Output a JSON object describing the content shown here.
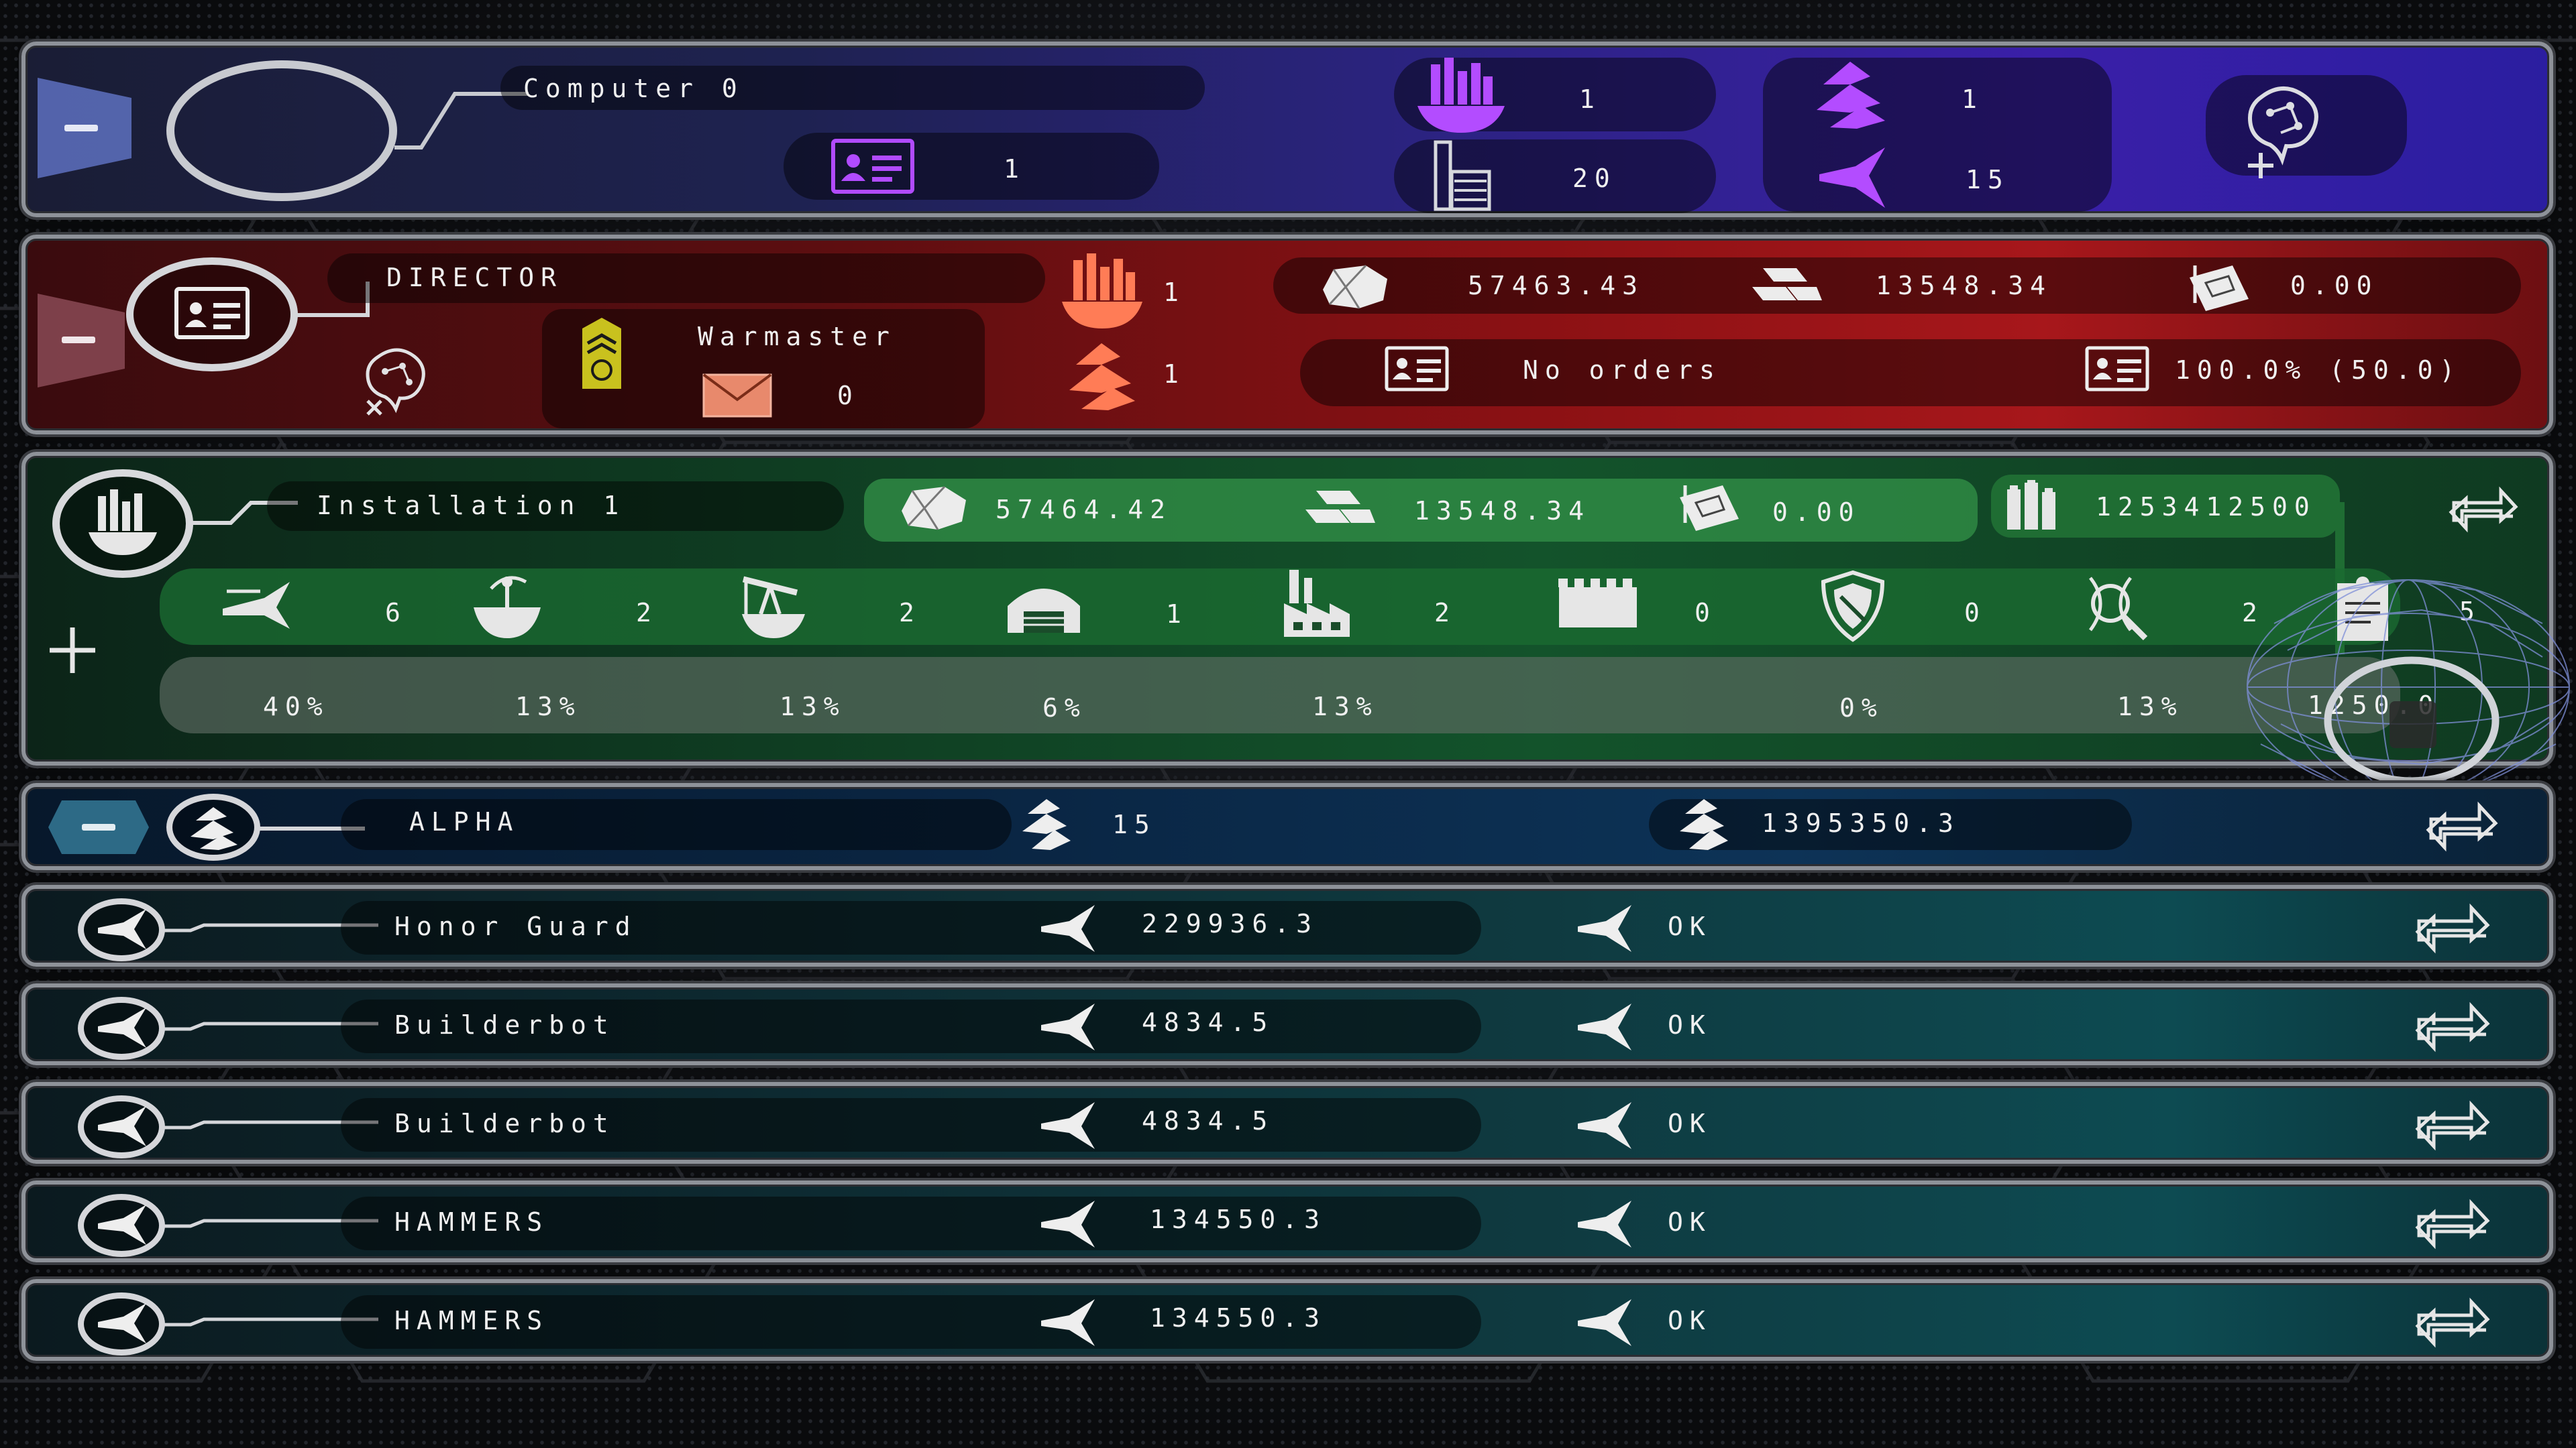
{
  "computer": {
    "name": "Computer 0",
    "id_count": "1",
    "cities_count": "1",
    "buildings_count": "20",
    "fleet_count": "1",
    "ships_count": "15",
    "colors": {
      "accent": "#a64bff",
      "panel": "#2b2380"
    }
  },
  "director": {
    "role": "DIRECTOR",
    "rank": "Warmaster",
    "mail_count": "0",
    "cities_count": "1",
    "fleets_count": "1",
    "ore": "57463.43",
    "metal": "13548.34",
    "research": "0.00",
    "orders": "No orders",
    "efficiency": "100.0% (50.0)",
    "colors": {
      "accent": "#ff7a55",
      "panel": "#a7171b"
    }
  },
  "installation": {
    "name": "Installation 1",
    "ore": "57464.42",
    "metal": "13548.34",
    "research": "0.00",
    "credits": "1253412500",
    "buildings": [
      {
        "icon": "shipyard-icon",
        "count": "6",
        "percent": "40%"
      },
      {
        "icon": "satellite-dish-icon",
        "count": "2",
        "percent": "13%"
      },
      {
        "icon": "pumpjack-icon",
        "count": "2",
        "percent": "13%"
      },
      {
        "icon": "hangar-icon",
        "count": "1",
        "percent": "6%"
      },
      {
        "icon": "factory-icon",
        "count": "2",
        "percent": "13%"
      },
      {
        "icon": "wall-icon",
        "count": "0",
        "percent": ""
      },
      {
        "icon": "shield-icon",
        "count": "0",
        "percent": "0%"
      },
      {
        "icon": "research-lab-icon",
        "count": "2",
        "percent": "13%"
      },
      {
        "icon": "document-icon",
        "count": "5",
        "percent": "1250.0"
      }
    ],
    "colors": {
      "accent": "#7fe09a",
      "panel": "#13532b"
    }
  },
  "fleet": {
    "name": "ALPHA",
    "ship_count": "15",
    "strength": "1395350.3",
    "colors": {
      "panel": "#0d3357"
    }
  },
  "ships": [
    {
      "name": "Honor Guard",
      "strength": "229936.3",
      "status": "OK"
    },
    {
      "name": "Builderbot",
      "strength": "4834.5",
      "status": "OK"
    },
    {
      "name": "Builderbot",
      "strength": "4834.5",
      "status": "OK"
    },
    {
      "name": "HAMMERS",
      "strength": "134550.3",
      "status": "OK"
    },
    {
      "name": "HAMMERS",
      "strength": "134550.3",
      "status": "OK"
    }
  ]
}
